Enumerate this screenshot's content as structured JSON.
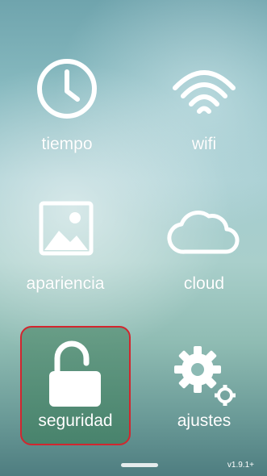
{
  "menu": {
    "tiles": [
      {
        "label": "tiempo",
        "icon": "clock-icon"
      },
      {
        "label": "wifi",
        "icon": "wifi-icon"
      },
      {
        "label": "apariencia",
        "icon": "image-icon"
      },
      {
        "label": "cloud",
        "icon": "cloud-icon"
      },
      {
        "label": "seguridad",
        "icon": "unlocked-padlock-icon",
        "highlighted": true
      },
      {
        "label": "ajustes",
        "icon": "gears-icon"
      }
    ]
  },
  "footer": {
    "version": "v1.9.1+"
  },
  "colors": {
    "highlight_border": "#d2262e",
    "icon_stroke": "#ffffff"
  }
}
